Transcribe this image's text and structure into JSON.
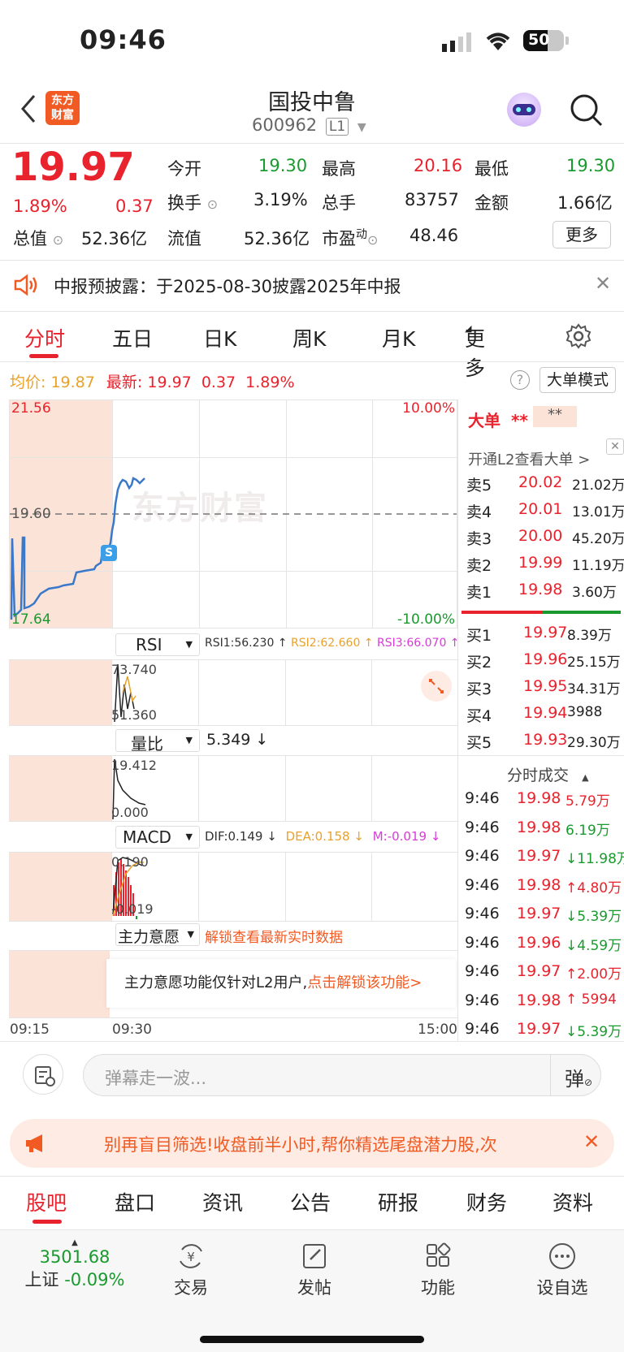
{
  "status": {
    "time": "09:46",
    "battery": "50"
  },
  "header": {
    "logo_line1": "东方",
    "logo_line2": "财富",
    "title": "国投中鲁",
    "code": "600962",
    "level": "L1"
  },
  "quote": {
    "price": "19.97",
    "change_pct": "1.89%",
    "change": "0.37",
    "open_label": "今开",
    "open": "19.30",
    "high_label": "最高",
    "high": "20.16",
    "low_label": "最低",
    "low": "19.30",
    "turnover_label": "换手",
    "turnover": "3.19%",
    "vol_label": "总手",
    "vol": "83757",
    "amount_label": "金额",
    "amount": "1.66亿",
    "mktcap_label": "总值",
    "mktcap": "52.36亿",
    "float_label": "流值",
    "float": "52.36亿",
    "pe_label": "市盈",
    "pe_sup": "动",
    "pe": "48.46",
    "more": "更多"
  },
  "notice": {
    "text": "中报预披露：于2025-08-30披露2025年中报"
  },
  "tabs": [
    "分时",
    "五日",
    "日K",
    "周K",
    "月K",
    "更多"
  ],
  "info": {
    "avg_label": "均价:",
    "avg": "19.87",
    "latest_label": "最新:",
    "latest": "19.97",
    "chg": "0.37",
    "pct": "1.89%",
    "mode": "大单模式"
  },
  "chart": {
    "top": "21.56",
    "mid": "19.60",
    "bottom": "17.64",
    "top_pct": "10.00%",
    "bottom_pct": "-10.00%",
    "watermark": "东方财富",
    "s_badge": "S",
    "x_start": "09:15",
    "x_mid": "09:30",
    "x_end": "15:00"
  },
  "rsi": {
    "label": "RSI",
    "r1": "RSI1:56.230 ↑",
    "r2": "RSI2:62.660 ↑",
    "r3": "RSI3:66.070 ↑",
    "max": "73.740",
    "min": "51.360"
  },
  "vr": {
    "label": "量比",
    "val": "5.349 ↓",
    "max": "19.412",
    "min": "0.000"
  },
  "macd": {
    "label": "MACD",
    "dif": "DIF:0.149 ↓",
    "dea": "DEA:0.158 ↓",
    "m": "M:-0.019 ↓",
    "max": "0.190",
    "min": "-0.019"
  },
  "zl": {
    "label": "主力意愿",
    "unlock": "解锁查看最新实时数据",
    "msg": "主力意愿功能仅针对L2用户,",
    "msg_link": "点击解锁该功能>"
  },
  "bigorder": {
    "title": "大单",
    "stars1": "**",
    "stars2": "**",
    "l2": "开通L2查看大单 >"
  },
  "sell": [
    {
      "l": "卖5",
      "p": "20.02",
      "v": "21.02万"
    },
    {
      "l": "卖4",
      "p": "20.01",
      "v": "13.01万"
    },
    {
      "l": "卖3",
      "p": "20.00",
      "v": "45.20万"
    },
    {
      "l": "卖2",
      "p": "19.99",
      "v": "11.19万"
    },
    {
      "l": "卖1",
      "p": "19.98",
      "v": "3.60万"
    }
  ],
  "buy": [
    {
      "l": "买1",
      "p": "19.97",
      "v": "8.39万"
    },
    {
      "l": "买2",
      "p": "19.96",
      "v": "25.15万"
    },
    {
      "l": "买3",
      "p": "19.95",
      "v": "34.31万"
    },
    {
      "l": "买4",
      "p": "19.94",
      "v": "3988"
    },
    {
      "l": "买5",
      "p": "19.93",
      "v": "29.30万"
    }
  ],
  "trades_title": "分时成交",
  "trades": [
    {
      "t": "9:46",
      "p": "19.98",
      "v": "5.79万",
      "c": "red"
    },
    {
      "t": "9:46",
      "p": "19.98",
      "v": "6.19万",
      "c": "green"
    },
    {
      "t": "9:46",
      "p": "19.97",
      "v": "↓11.98万",
      "c": "green"
    },
    {
      "t": "9:46",
      "p": "19.98",
      "v": "↑4.80万",
      "c": "red"
    },
    {
      "t": "9:46",
      "p": "19.97",
      "v": "↓5.39万",
      "c": "green"
    },
    {
      "t": "9:46",
      "p": "19.96",
      "v": "↓4.59万",
      "c": "green"
    },
    {
      "t": "9:46",
      "p": "19.97",
      "v": "↑2.00万",
      "c": "red"
    },
    {
      "t": "9:46",
      "p": "19.98",
      "v": "↑ 5994",
      "c": "red"
    },
    {
      "t": "9:46",
      "p": "19.97",
      "v": "↓5.39万",
      "c": "green"
    }
  ],
  "comment": {
    "placeholder": "弹幕走一波...",
    "danmu": "弹"
  },
  "banner": {
    "text": "别再盲目筛选!收盘前半小时,帮你精选尾盘潜力股,次"
  },
  "nav": [
    "股吧",
    "盘口",
    "资讯",
    "公告",
    "研报",
    "财务",
    "资料"
  ],
  "bottom": {
    "index": "3501.68",
    "index_name": "上证",
    "index_pct": "-0.09%",
    "trade": "交易",
    "post": "发帖",
    "func": "功能",
    "watch": "设自选"
  }
}
